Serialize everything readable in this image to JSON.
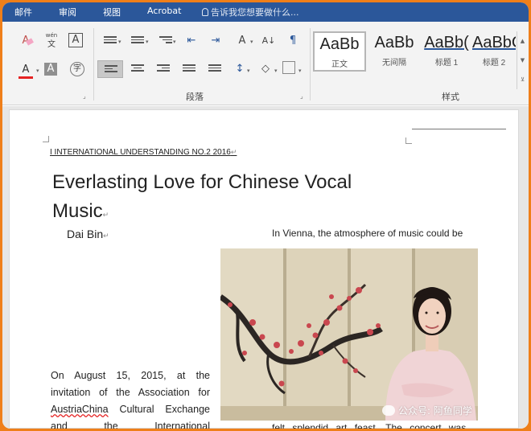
{
  "menubar": {
    "tabs": [
      "邮件",
      "审阅",
      "视图",
      "Acrobat"
    ],
    "tell_me": "告诉我您想要做什么..."
  },
  "ribbon": {
    "groups": {
      "paragraph": "段落",
      "styles": "样式"
    },
    "styles": [
      {
        "sample": "AaBb",
        "name": "正文",
        "selected": true
      },
      {
        "sample": "AaBb",
        "name": "无间隔",
        "selected": false
      },
      {
        "sample": "AaBb(",
        "name": "标题 1",
        "selected": false
      },
      {
        "sample": "AaBbC",
        "name": "标题 2",
        "selected": false
      }
    ],
    "icons": {
      "clear_format": "clear-formatting-icon",
      "phonetic": "phonetic-guide-icon",
      "char_border": "character-border-icon",
      "font_color": "font-color-icon",
      "char_shading": "character-shading-icon",
      "enclose_char": "enclose-characters-icon",
      "bullets": "bullets-icon",
      "numbering": "numbering-icon",
      "multilevel": "multilevel-list-icon",
      "decrease_indent": "decrease-indent-icon",
      "increase_indent": "increase-indent-icon",
      "asian_layout": "asian-layout-icon",
      "sort": "sort-icon",
      "show_marks": "show-hide-marks-icon",
      "align_left": "align-left-icon",
      "center": "center-icon",
      "align_right": "align-right-icon",
      "justify": "justify-icon",
      "distributed": "distributed-icon",
      "line_spacing": "line-spacing-icon",
      "shading": "shading-icon",
      "borders": "borders-icon"
    },
    "glyphs": {
      "clear_format": "A",
      "phonetic_top": "wén",
      "phonetic_bottom": "文",
      "char_border": "A",
      "font_color": "A",
      "char_shading": "A",
      "enclose_char": "字",
      "asian_layout": "A",
      "sort": "A↓",
      "show_marks": "¶"
    },
    "colors": {
      "accent": "#2b579a",
      "font_color_bar": "#e52222"
    }
  },
  "document": {
    "header": "I INTERNATIONAL UNDERSTANDING NO.2 2016",
    "title_line1": "Everlasting Love for Chinese Vocal",
    "title_line2": "Music",
    "author": "Dai Bin",
    "right_intro": "In Vienna, the atmosphere of music could be",
    "left_para": {
      "line1": "On August 15, 2015, at the",
      "line2": "invitation of the Association for",
      "line3_word1": "AustriaChina",
      "line3_rest": " Cultural Exchange",
      "line4": "and the International"
    },
    "right_bottom": "felt splendid art feast. The concert was",
    "paragraph_mark": "↵"
  },
  "watermark": "公众号: 阿鱼同学"
}
